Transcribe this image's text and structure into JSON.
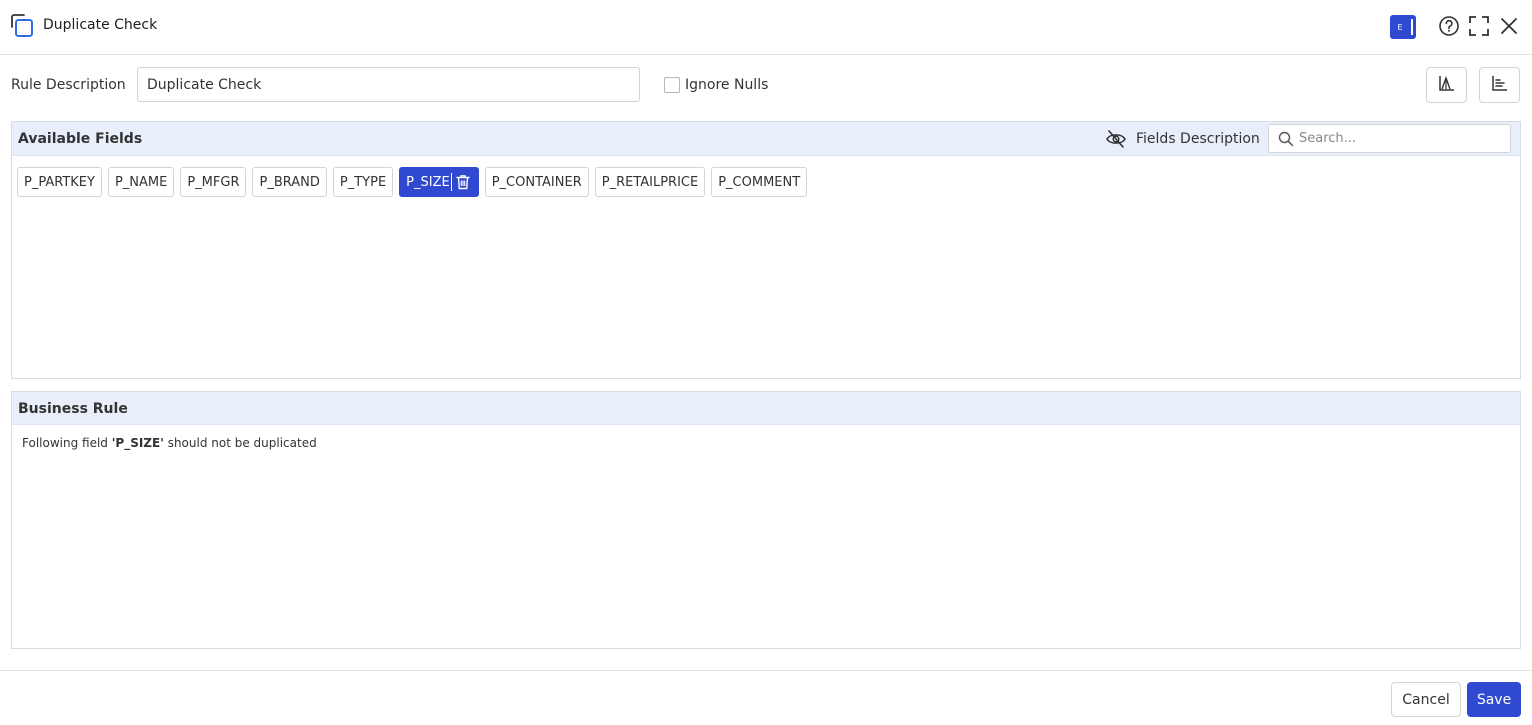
{
  "header": {
    "title": "Duplicate Check",
    "env_badge": "E",
    "icons": [
      "copy-icon",
      "help-icon",
      "expand-icon",
      "close-icon"
    ]
  },
  "form": {
    "rule_description_label": "Rule Description",
    "rule_description_value": "Duplicate Check",
    "ignore_nulls_label": "Ignore Nulls",
    "ignore_nulls_checked": false
  },
  "available_fields": {
    "title": "Available Fields",
    "fields_description_label": "Fields Description",
    "search_placeholder": "Search...",
    "fields": [
      {
        "label": "P_PARTKEY",
        "selected": false
      },
      {
        "label": "P_NAME",
        "selected": false
      },
      {
        "label": "P_MFGR",
        "selected": false
      },
      {
        "label": "P_BRAND",
        "selected": false
      },
      {
        "label": "P_TYPE",
        "selected": false
      },
      {
        "label": "P_SIZE",
        "selected": true
      },
      {
        "label": "P_CONTAINER",
        "selected": false
      },
      {
        "label": "P_RETAILPRICE",
        "selected": false
      },
      {
        "label": "P_COMMENT",
        "selected": false
      }
    ]
  },
  "business_rule": {
    "title": "Business Rule",
    "text_prefix": "Following field ",
    "field": "'P_SIZE'",
    "text_suffix": " should not be duplicated"
  },
  "footer": {
    "cancel_label": "Cancel",
    "save_label": "Save"
  },
  "colors": {
    "accent": "#2f49d1",
    "panel_header": "#e9eefb"
  }
}
